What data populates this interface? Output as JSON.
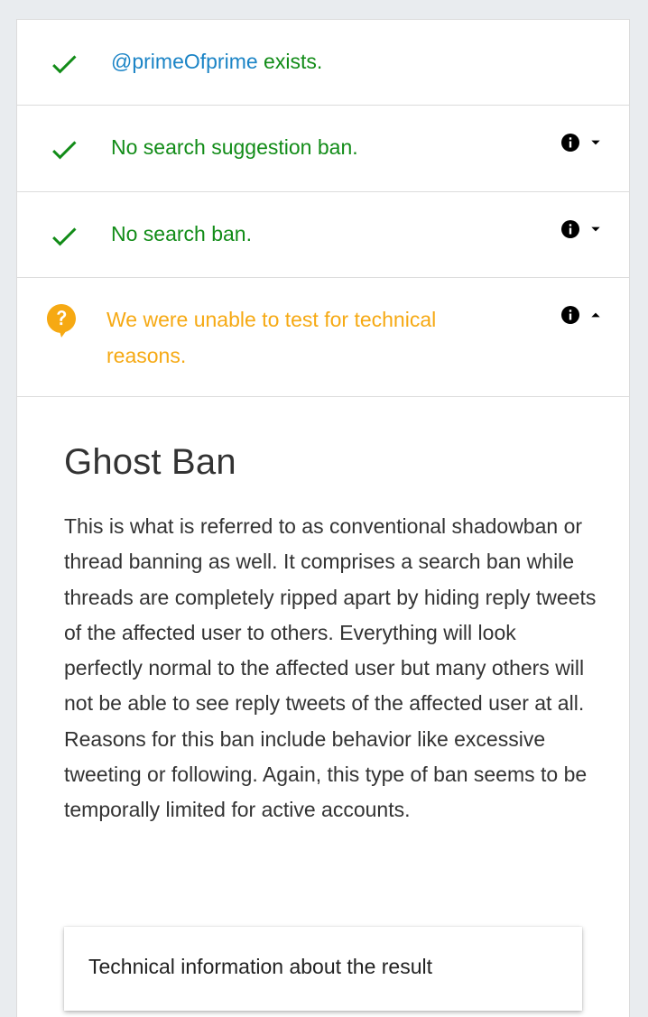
{
  "results": {
    "exists": {
      "handle": "@primeOfprime",
      "suffix": " exists.",
      "icon": "check-icon",
      "status": "pass"
    },
    "search_suggestion": {
      "label": "No search suggestion ban.",
      "icon": "check-icon",
      "status": "pass"
    },
    "search": {
      "label": "No search ban.",
      "icon": "check-icon",
      "status": "pass"
    },
    "ghost": {
      "label": "We were unable to test for technical reasons.",
      "icon": "question-bubble-icon",
      "status": "unknown",
      "expanded": true
    }
  },
  "detail": {
    "title": "Ghost Ban",
    "body": "This is what is referred to as conventional shadowban or thread banning as well. It comprises a search ban while threads are completely ripped apart by hiding reply tweets of the affected user to others. Everything will look perfectly normal to the affected user but many others will not be able to see reply tweets of the affected user at all. Reasons for this ban include behavior like excessive tweeting or following. Again, this type of ban seems to be temporally limited for active accounts.",
    "technical_info_label": "Technical information about the result"
  },
  "colors": {
    "pass": "#128c18",
    "handle": "#1b84c6",
    "unknown": "#f6a913",
    "page_bg": "#e9ecef"
  }
}
